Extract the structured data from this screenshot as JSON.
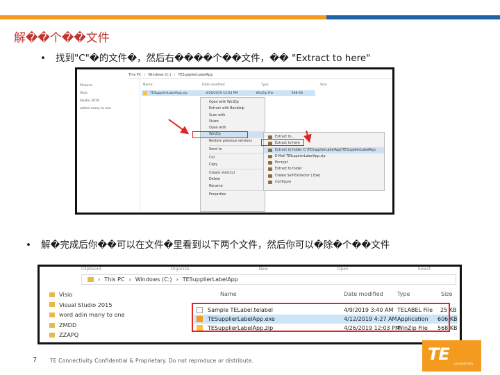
{
  "title": "解��个��文件",
  "bullet1": "找到\"C\"�的文件�，然后右����个��文件，��   \"Extract to here\"",
  "bullet2": "解�完成后你��可以在文件�里看到以下两个文件，然后你可以�除�个��文件",
  "bullet_glyph": "•",
  "shot1": {
    "breadcrumb": [
      "This PC",
      "Windows (C:)",
      "TESupplierLabelApp"
    ],
    "sidebar": [
      "Pictures",
      "Visio",
      "Studio 2019",
      "admin many to one"
    ],
    "columns": [
      "Name",
      "Date modified",
      "Type",
      "Size"
    ],
    "file": {
      "name": "TESupplierLabelApp.zip",
      "date": "4/26/2019 12:03 PM",
      "type": "WinZip File",
      "size": "568 KB"
    },
    "context_menu": [
      "Open with WinZip",
      "Extract with Bandizip",
      "Scan with",
      "Share",
      "Open with",
      "WinZip",
      "Restore previous versions",
      "Send to",
      "Cut",
      "Copy",
      "Create shortcut",
      "Delete",
      "Rename",
      "Properties"
    ],
    "submenu": [
      "Extract to...",
      "Extract to here",
      "Extract to folder C:\\TESupplierLabelApp\\TESupplierLabelApp",
      "E-Mail TESupplierLabelApp.zip",
      "Encrypt",
      "Extract to folder",
      "Create Self-Extractor (.Exe)",
      "Configure"
    ]
  },
  "shot2": {
    "ribbon": [
      "Clipboard",
      "Organize",
      "New",
      "Open",
      "Select"
    ],
    "breadcrumb": [
      "This PC",
      "Windows (C:)",
      "TESupplierLabelApp"
    ],
    "sidebar": [
      "Visio",
      "Visual Studio 2015",
      "word adin many to one",
      "ZMDD",
      "ZZAPQ"
    ],
    "columns": [
      "Name",
      "Date modified",
      "Type",
      "Size"
    ],
    "rows": [
      {
        "name": "Sample TELabel.telabel",
        "date": "4/9/2019 3:40 AM",
        "type": "TELABEL File",
        "size": "25 KB"
      },
      {
        "name": "TESupplierLabelApp.exe",
        "date": "4/12/2019 4:27 AM",
        "type": "Application",
        "size": "606 KB"
      },
      {
        "name": "TESupplierLabelApp.zip",
        "date": "4/26/2019 12:03 PM",
        "type": "WinZip File",
        "size": "568 KB"
      }
    ]
  },
  "page_number": "7",
  "footer": "TE Connectivity Confidential & Proprietary. Do not reproduce or distribute.",
  "logo": {
    "text": "TE",
    "sub": "connectivity"
  },
  "colors": {
    "accent_orange": "#f39a1f",
    "accent_blue": "#1f63a6",
    "title_red": "#c0322a",
    "highlight_red": "#e02424"
  }
}
